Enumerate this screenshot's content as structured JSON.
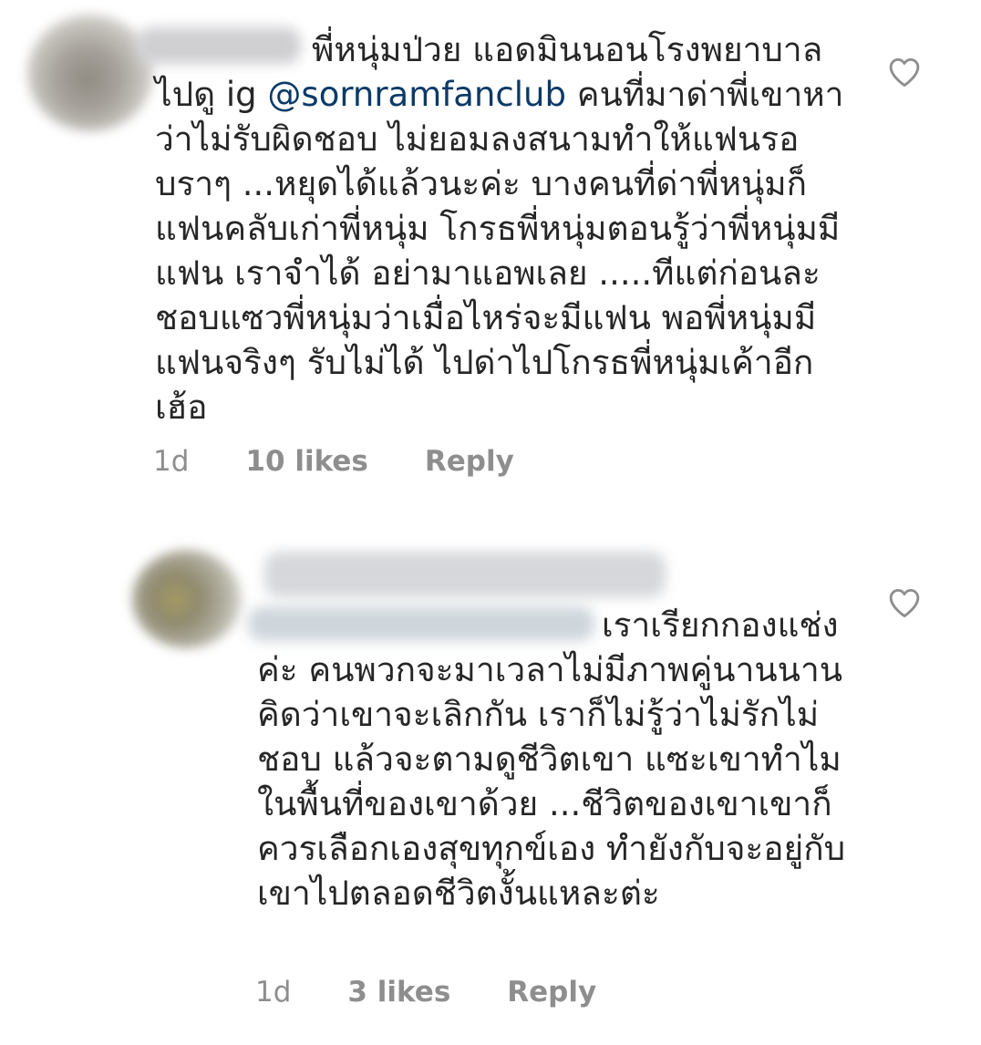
{
  "comments": [
    {
      "text_before_handle": "พี่หนุ่มป่วย แอดมินนอนโรงพยาบาล ไปดู ig ",
      "handle": "@sornramfanclub",
      "text_after_handle": " คนที่มาด่าพี่เขาหาว่าไม่รับผิดชอบ ไม่ยอมลงสนามทำให้แฟนรอ บราๆ ...หยุดได้แล้วนะค่ะ บางคนที่ด่าพี่หนุ่มก็แฟนคลับเก่าพี่หนุ่ม โกรธพี่หนุ่มตอนรู้ว่าพี่หนุ่มมีแฟน เราจำได้ อย่ามาแอพเลย .....ทีแต่ก่อนละชอบแซวพี่หนุ่มว่าเมื่อไหร่จะมีแฟน พอพี่หนุ่มมีแฟนจริงๆ รับไม่ได้ ไปด่าไปโกรธพี่หนุ่มเค้าอีก เฮ้อ",
      "time": "1d",
      "likes": "10 likes",
      "reply": "Reply",
      "like_icon": "heart-outline-icon"
    },
    {
      "text": "เราเรียกกองแช่งค่ะ คนพวกจะมาเวลาไม่มีภาพคู่นานนาน คิดว่าเขาจะเลิกกัน เราก็ไม่รู้ว่าไม่รักไม่ชอบ แล้วจะตามดูชีวิตเขา แซะเขาทำไม ในพื้นที่ของเขาด้วย ...ชีวิตของเขาเขาก็ควรเลือกเองสุขทุกข์เอง ทำยังกับจะอยู่กับเขาไปตลอดชีวิตงั้นแหละต่ะ",
      "time": "1d",
      "likes": "3 likes",
      "reply": "Reply",
      "like_icon": "heart-outline-icon"
    }
  ],
  "colors": {
    "text": "#262626",
    "meta": "#8e8e8e",
    "mention": "#0b3a67",
    "background": "#ffffff"
  }
}
